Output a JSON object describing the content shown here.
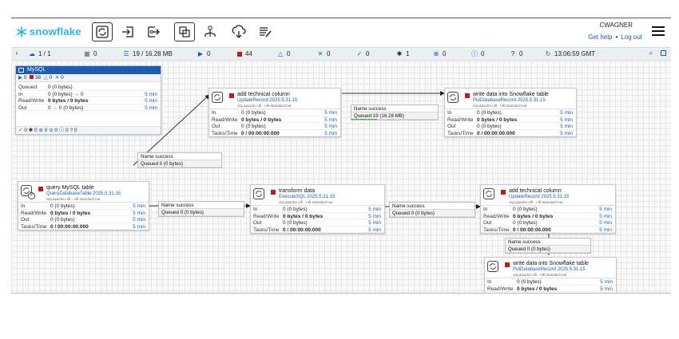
{
  "header": {
    "logo_text": "snowflake",
    "user": "CWAGNER",
    "get_help": "Get help",
    "logout": "Log out",
    "toolbar": [
      "processor-icon",
      "input-port-icon",
      "output-port-icon",
      "process-group-icon",
      "remote-process-group-icon",
      "funnel-icon",
      "template-icon",
      "label-icon"
    ]
  },
  "status": {
    "cluster": "1 / 1",
    "threads": "0",
    "queued": "19 / 16.28 MB",
    "running": "0",
    "stopped": "44",
    "invalid": "0",
    "disabled": "0",
    "up_to_date": "0",
    "modified": "1",
    "stale": "0",
    "errors": "0",
    "unknown": "0",
    "time": "13:06:59 GMT"
  },
  "process_group": {
    "name": "MySQL",
    "counts": "0  38  0  0",
    "running": "0",
    "stopped": "38",
    "invalid": "0",
    "disabled": "0",
    "rows": [
      {
        "k": "Queued",
        "v": "0 (0 bytes)",
        "t": ""
      },
      {
        "k": "In",
        "v": "0 (0 bytes) → 0",
        "t": "5 min"
      },
      {
        "k": "Read/Write",
        "v": "0 bytes / 0 bytes",
        "t": "5 min"
      },
      {
        "k": "Out",
        "v": "0 → 0 (0 bytes)",
        "t": "5 min"
      }
    ],
    "footer": "0  0  0  0  0  0"
  },
  "processors": [
    {
      "id": "p1",
      "name": "add technical column",
      "type": "UpdateRecord 2025.5.31.15",
      "bundle": "org.apache.nifi - nifi-standard-nar",
      "rows": [
        {
          "k": "In",
          "v": "0 (0 bytes)",
          "t": "5 min"
        },
        {
          "k": "Read/Write",
          "v": "0 bytes / 0 bytes",
          "t": "5 min"
        },
        {
          "k": "Out",
          "v": "0 (0 bytes)",
          "t": "5 min"
        },
        {
          "k": "Tasks/Time",
          "v": "0 / 00:00:00.000",
          "t": "5 min"
        }
      ]
    },
    {
      "id": "p2",
      "name": "write data into Snowflake table",
      "type": "PutDatabaseRecord 2025.5.31.15",
      "bundle": "org.apache.nifi - nifi-standard-nar",
      "rows": [
        {
          "k": "In",
          "v": "0 (0 bytes)",
          "t": "5 min"
        },
        {
          "k": "Read/Write",
          "v": "0 bytes / 0 bytes",
          "t": "5 min"
        },
        {
          "k": "Out",
          "v": "0 (0 bytes)",
          "t": "5 min"
        },
        {
          "k": "Tasks/Time",
          "v": "0 / 00:00:00.000",
          "t": "5 min"
        }
      ]
    },
    {
      "id": "p3",
      "name": "query MySQL table",
      "type": "QueryDatabaseTable 2025.5.31.15",
      "bundle": "org.apache.nifi - nifi-standard-nar",
      "rows": [
        {
          "k": "In",
          "v": "0 (0 bytes)",
          "t": "5 min"
        },
        {
          "k": "Read/Write",
          "v": "0 bytes / 0 bytes",
          "t": "5 min"
        },
        {
          "k": "Out",
          "v": "0 (0 bytes)",
          "t": "5 min"
        },
        {
          "k": "Tasks/Time",
          "v": "0 / 00:00:00.000",
          "t": "5 min"
        }
      ]
    },
    {
      "id": "p4",
      "name": "transform data",
      "type": "ExecuteSQL 2025.5.31.15",
      "bundle": "org.apache.nifi - nifi-standard-nar",
      "rows": [
        {
          "k": "In",
          "v": "0 (0 bytes)",
          "t": "5 min"
        },
        {
          "k": "Read/Write",
          "v": "0 bytes / 0 bytes",
          "t": "5 min"
        },
        {
          "k": "Out",
          "v": "0 (0 bytes)",
          "t": "5 min"
        },
        {
          "k": "Tasks/Time",
          "v": "0 / 00:00:00.000",
          "t": "5 min"
        }
      ]
    },
    {
      "id": "p5",
      "name": "add technical column",
      "type": "UpdateRecord 2025.5.31.15",
      "bundle": "org.apache.nifi - nifi-standard-nar",
      "rows": [
        {
          "k": "In",
          "v": "0 (0 bytes)",
          "t": "5 min"
        },
        {
          "k": "Read/Write",
          "v": "0 bytes / 0 bytes",
          "t": "5 min"
        },
        {
          "k": "Out",
          "v": "0 (0 bytes)",
          "t": "5 min"
        },
        {
          "k": "Tasks/Time",
          "v": "0 / 00:00:00.000",
          "t": "5 min"
        }
      ]
    },
    {
      "id": "p6",
      "name": "write data into Snowflake table",
      "type": "PutDatabaseRecord 2025.5.31.15",
      "bundle": "org.apache.nifi - nifi-standard-nar",
      "rows": [
        {
          "k": "In",
          "v": "0 (0 bytes)",
          "t": "5 min"
        },
        {
          "k": "Read/Write",
          "v": "0 bytes / 0 bytes",
          "t": "5 min"
        },
        {
          "k": "Out",
          "v": "0 (0 bytes)",
          "t": "5 min"
        },
        {
          "k": "Tasks/Time",
          "v": "0 / 00:00:00.000",
          "t": "5 min"
        }
      ]
    }
  ],
  "connections": [
    {
      "id": "c1",
      "name": "Name  success",
      "queued": "Queued  0 (0 bytes)"
    },
    {
      "id": "c2",
      "name": "Name  success",
      "queued": "Queued  19 (16.28 MB)"
    },
    {
      "id": "c3",
      "name": "Name  success",
      "queued": "Queued  0 (0 bytes)"
    },
    {
      "id": "c4",
      "name": "Name  success",
      "queued": "Queued  0 (0 bytes)"
    },
    {
      "id": "c5",
      "name": "Name  success",
      "queued": "Queued  0 (0 bytes)"
    }
  ],
  "colors": {
    "accent": "#1c5bb8",
    "stopped": "#c9151d",
    "brand": "#29b5e8"
  }
}
